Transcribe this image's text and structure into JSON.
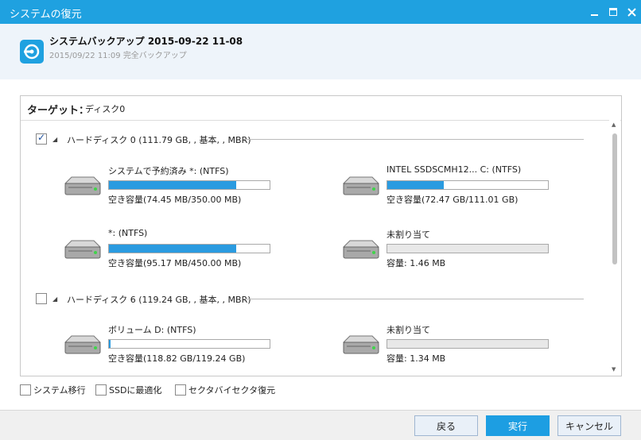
{
  "window": {
    "title": "システムの復元"
  },
  "header": {
    "title": "システムバックアップ 2015-09-22 11-08",
    "subtitle": "2015/09/22 11:09 完全バックアップ"
  },
  "target": {
    "label": "ターゲット：",
    "value": "ディスク0"
  },
  "disks": [
    {
      "label": "ハードディスク 0 (111.79 GB, , 基本, , MBR)",
      "checked": true,
      "partitions": [
        {
          "name": "システムで予約済み *: (NTFS)",
          "free": "空き容量(74.45 MB/350.00 MB)",
          "used_fraction": 0.79,
          "unallocated": false
        },
        {
          "name": "INTEL SSDSCMH12... C: (NTFS)",
          "free": "空き容量(72.47 GB/111.01 GB)",
          "used_fraction": 0.35,
          "unallocated": false
        },
        {
          "name": "*: (NTFS)",
          "free": "空き容量(95.17 MB/450.00 MB)",
          "used_fraction": 0.79,
          "unallocated": false
        },
        {
          "name": "未割り当て",
          "free": "容量: 1.46 MB",
          "used_fraction": 0,
          "unallocated": true
        }
      ]
    },
    {
      "label": "ハードディスク 6 (119.24 GB, , 基本, , MBR)",
      "checked": false,
      "partitions": [
        {
          "name": "ボリューム D: (NTFS)",
          "free": "空き容量(118.82 GB/119.24 GB)",
          "used_fraction": 0.01,
          "unallocated": false
        },
        {
          "name": "未割り当て",
          "free": "容量: 1.34 MB",
          "used_fraction": 0,
          "unallocated": true
        }
      ]
    }
  ],
  "options": {
    "system_migrate": "システム移行",
    "ssd_optimize": "SSDに最適化",
    "sector_restore": "セクタバイセクタ復元"
  },
  "buttons": {
    "back": "戻る",
    "execute": "実行",
    "cancel": "キャンセル"
  },
  "colors": {
    "accent": "#1fa1e0",
    "bar_fill": "#2b9be0"
  }
}
